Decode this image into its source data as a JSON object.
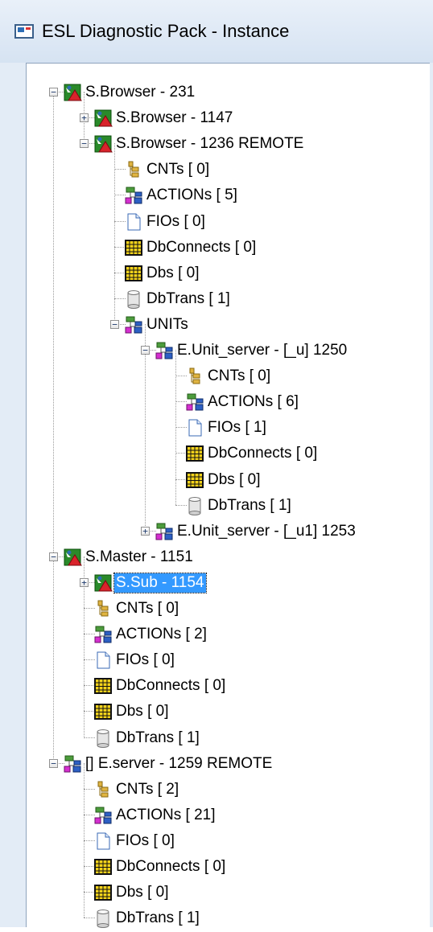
{
  "window": {
    "title": "ESL Diagnostic Pack - Instance"
  },
  "icons": {
    "service": "service-icon",
    "counter": "cnt-icon",
    "action": "action-icon",
    "file": "file-icon",
    "grid": "grid-icon",
    "db": "db-icon"
  },
  "tree": [
    {
      "label": "S.Browser -  231",
      "icon": "service",
      "level": 0,
      "expander": "minus"
    },
    {
      "label": "S.Browser -  1147",
      "icon": "service",
      "level": 1,
      "expander": "plus"
    },
    {
      "label": "S.Browser -  1236 REMOTE",
      "icon": "service",
      "level": 1,
      "expander": "minus"
    },
    {
      "label": "CNTs [ 0]",
      "icon": "counter",
      "level": 2,
      "expander": "none"
    },
    {
      "label": "ACTIONs [ 5]",
      "icon": "action",
      "level": 2,
      "expander": "none"
    },
    {
      "label": "FIOs [ 0]",
      "icon": "file",
      "level": 2,
      "expander": "none"
    },
    {
      "label": "DbConnects [ 0]",
      "icon": "grid",
      "level": 2,
      "expander": "none"
    },
    {
      "label": "Dbs [ 0]",
      "icon": "grid",
      "level": 2,
      "expander": "none"
    },
    {
      "label": "DbTrans [ 1]",
      "icon": "db",
      "level": 2,
      "expander": "none"
    },
    {
      "label": "UNITs",
      "icon": "action",
      "level": 2,
      "expander": "minus"
    },
    {
      "label": "E.Unit_server - [_u] 1250",
      "icon": "action",
      "level": 3,
      "expander": "minus"
    },
    {
      "label": "CNTs [ 0]",
      "icon": "counter",
      "level": 4,
      "expander": "none"
    },
    {
      "label": "ACTIONs [ 6]",
      "icon": "action",
      "level": 4,
      "expander": "none"
    },
    {
      "label": "FIOs [ 1]",
      "icon": "file",
      "level": 4,
      "expander": "none"
    },
    {
      "label": "DbConnects [ 0]",
      "icon": "grid",
      "level": 4,
      "expander": "none"
    },
    {
      "label": "Dbs [ 0]",
      "icon": "grid",
      "level": 4,
      "expander": "none"
    },
    {
      "label": "DbTrans [ 1]",
      "icon": "db",
      "level": 4,
      "expander": "none"
    },
    {
      "label": "E.Unit_server - [_u1] 1253",
      "icon": "action",
      "level": 3,
      "expander": "plus"
    },
    {
      "label": "S.Master -  1151",
      "icon": "service",
      "level": 0,
      "expander": "minus"
    },
    {
      "label": "S.Sub -  1154",
      "icon": "service",
      "level": 1,
      "expander": "plus",
      "selected": true
    },
    {
      "label": "CNTs [ 0]",
      "icon": "counter",
      "level": 1,
      "expander": "none"
    },
    {
      "label": "ACTIONs [ 2]",
      "icon": "action",
      "level": 1,
      "expander": "none"
    },
    {
      "label": "FIOs [ 0]",
      "icon": "file",
      "level": 1,
      "expander": "none"
    },
    {
      "label": "DbConnects [ 0]",
      "icon": "grid",
      "level": 1,
      "expander": "none"
    },
    {
      "label": "Dbs [ 0]",
      "icon": "grid",
      "level": 1,
      "expander": "none"
    },
    {
      "label": "DbTrans [ 1]",
      "icon": "db",
      "level": 1,
      "expander": "none"
    },
    {
      "label": "[] E.server -  1259 REMOTE",
      "icon": "action",
      "level": 0,
      "expander": "minus"
    },
    {
      "label": "CNTs [ 2]",
      "icon": "counter",
      "level": 1,
      "expander": "none"
    },
    {
      "label": "ACTIONs [ 21]",
      "icon": "action",
      "level": 1,
      "expander": "none"
    },
    {
      "label": "FIOs [ 0]",
      "icon": "file",
      "level": 1,
      "expander": "none"
    },
    {
      "label": "DbConnects [ 0]",
      "icon": "grid",
      "level": 1,
      "expander": "none"
    },
    {
      "label": "Dbs [ 0]",
      "icon": "grid",
      "level": 1,
      "expander": "none"
    },
    {
      "label": "DbTrans [ 1]",
      "icon": "db",
      "level": 1,
      "expander": "none"
    }
  ]
}
